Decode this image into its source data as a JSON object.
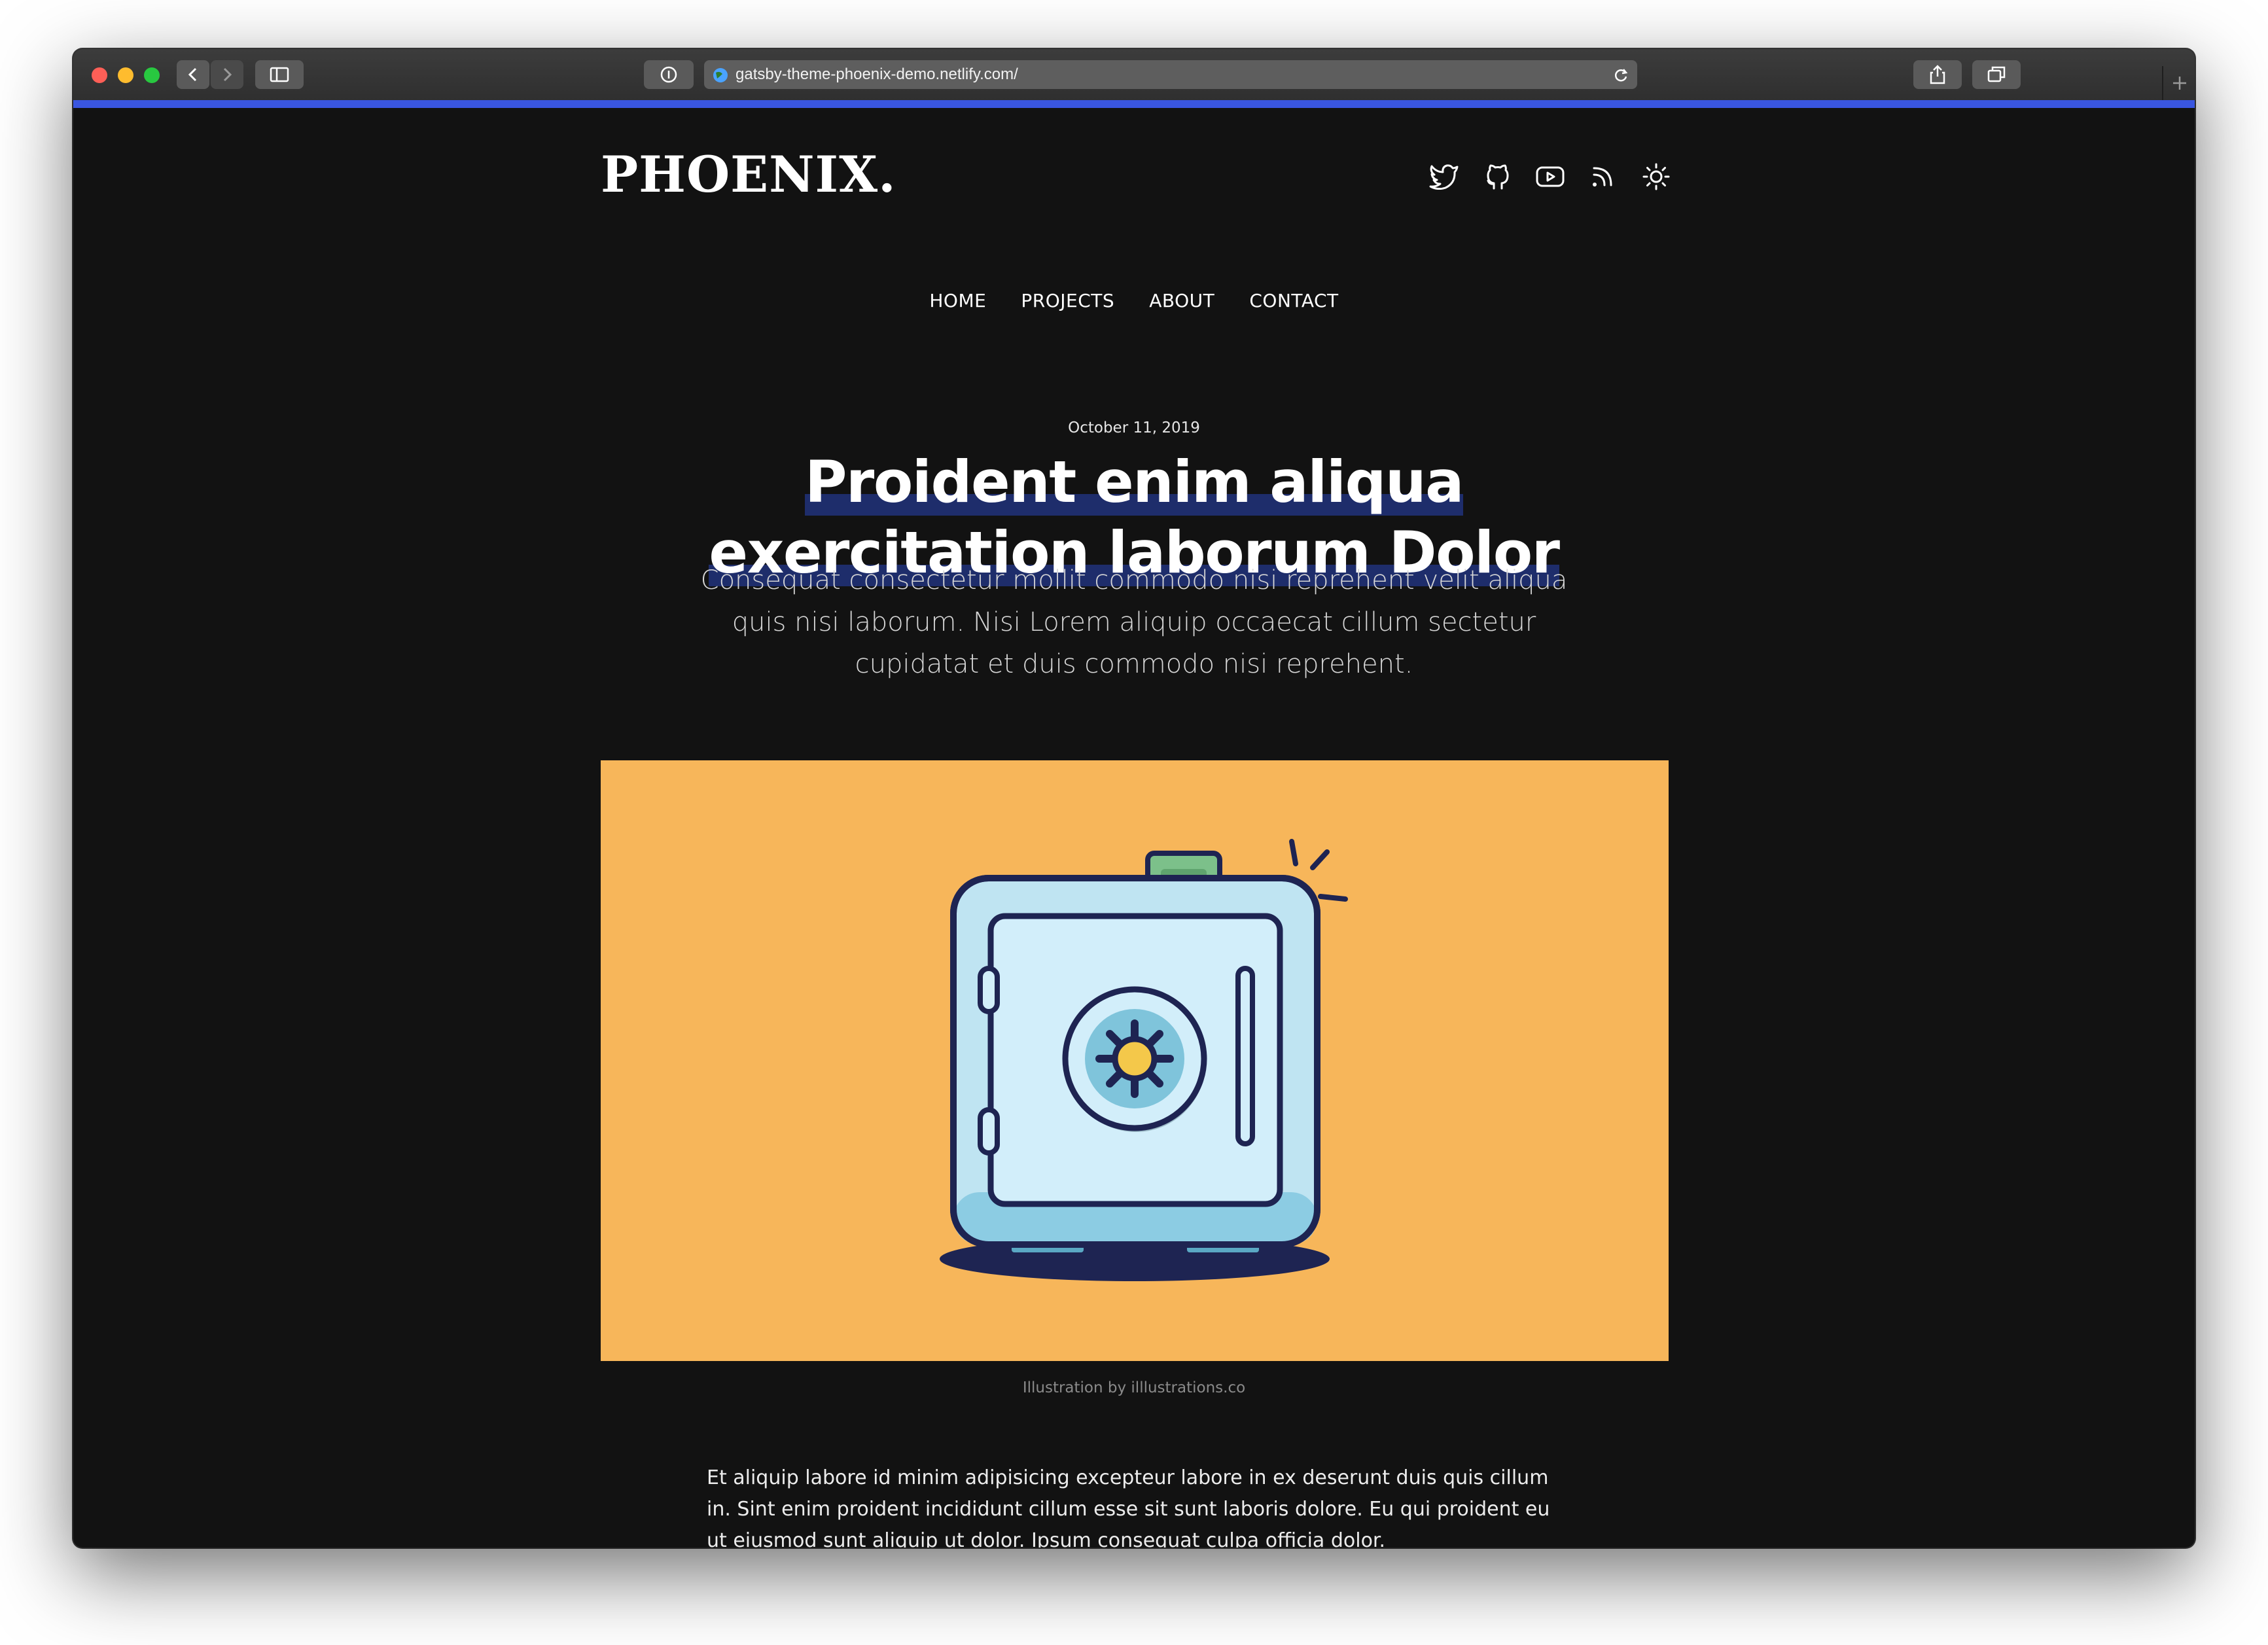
{
  "browser": {
    "url": "gatsby-theme-phoenix-demo.netlify.com/",
    "accent_color": "#3a56e0"
  },
  "site": {
    "logo": "PHOENIX.",
    "social_icons": [
      "twitter-icon",
      "github-icon",
      "youtube-icon",
      "rss-icon",
      "theme-toggle-icon"
    ]
  },
  "nav": {
    "items": [
      {
        "label": "HOME"
      },
      {
        "label": "PROJECTS"
      },
      {
        "label": "ABOUT"
      },
      {
        "label": "CONTACT"
      }
    ]
  },
  "post": {
    "date": "October 11, 2019",
    "title_line1": "Proident enim aliqua",
    "title_line2": "exercitation laborum Dolor",
    "subtitle": "Consequat consectetur mollit commodo nisi reprehent velit aliqua quis nisi laborum. Nisi Lorem aliquip occaecat cillum sectetur cupidatat et duis commodo nisi reprehent.",
    "hero_background": "#f7b65a",
    "hero_caption": "Illustration by illlustrations.co",
    "body": "Et aliquip labore id minim adipisicing excepteur labore in ex deserunt duis quis cillum in. Sint enim proident incididunt cillum esse sit sunt laboris dolore. Eu qui proident eu ut eiusmod sunt aliquip ut dolor. Ipsum consequat culpa officia dolor."
  }
}
